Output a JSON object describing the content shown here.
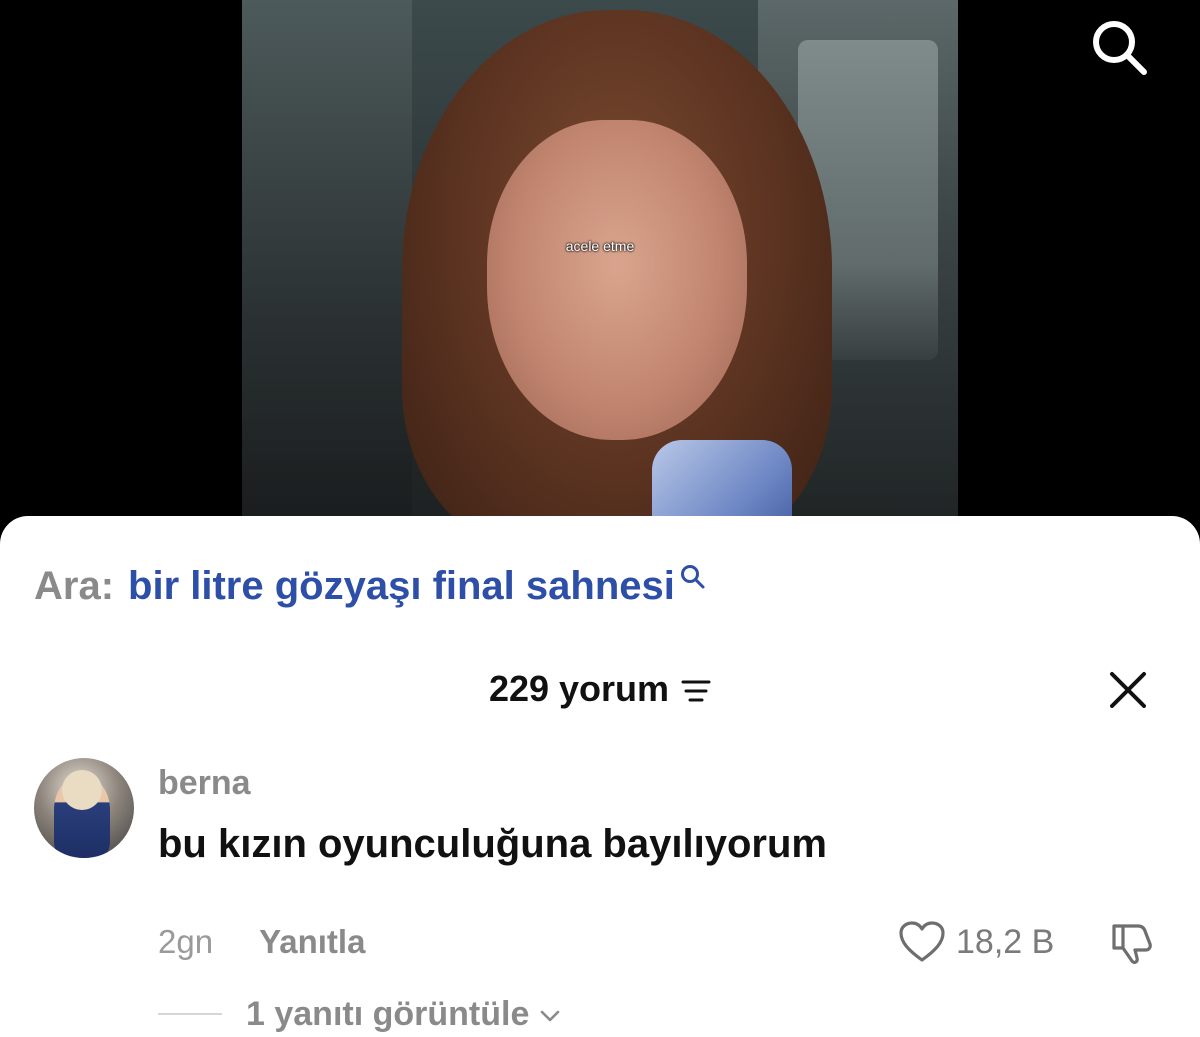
{
  "video": {
    "subtitle": "acele etme",
    "icons": {
      "search": "search-icon"
    }
  },
  "search_suggestion": {
    "prefix": "Ara:",
    "query": "bir litre gözyaşı final sahnesi",
    "icon": "search-icon"
  },
  "comments_header": {
    "count_label": "229 yorum",
    "filter_icon": "filter-icon",
    "close_icon": "close-icon"
  },
  "comment": {
    "username": "berna",
    "text": "bu kızın oyunculuğuna bayılıyorum",
    "time": "2gn",
    "reply_label": "Yanıtla",
    "like_count": "18,2 B",
    "like_icon": "heart-icon",
    "dislike_icon": "thumbs-down-icon",
    "view_replies_label": "1 yanıtı görüntüle",
    "view_replies_icon": "chevron-down-icon"
  },
  "colors": {
    "accent_link": "#2d4fa8",
    "muted_text": "#8a8a8a",
    "sheet_bg": "#ffffff",
    "screen_bg": "#000000"
  }
}
